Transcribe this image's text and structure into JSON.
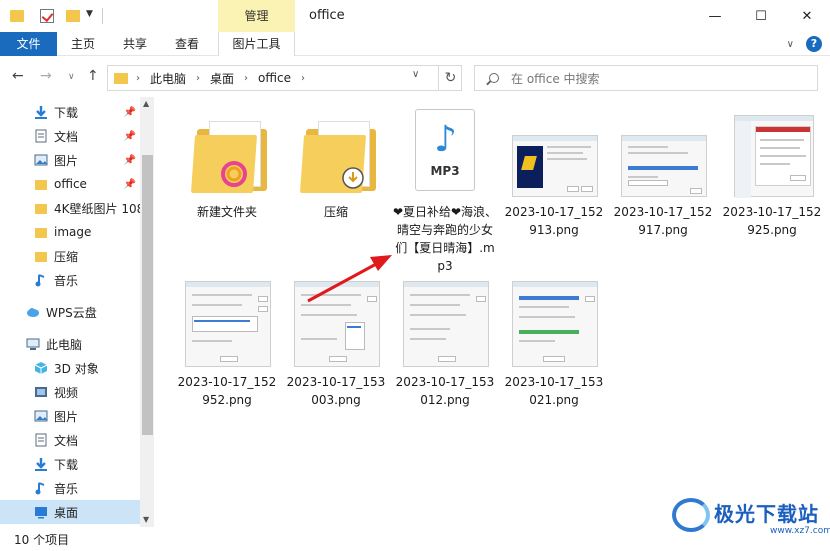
{
  "window": {
    "title": "office",
    "context_tab": "管理",
    "minimize_icon": "minimize-icon",
    "maximize_icon": "maximize-icon",
    "close_icon": "close-icon"
  },
  "ribbon": {
    "tabs": [
      "文件",
      "主页",
      "共享",
      "查看",
      "图片工具"
    ],
    "help_label": "?"
  },
  "address": {
    "segments": [
      "此电脑",
      "桌面",
      "office"
    ],
    "search_placeholder": "在 office 中搜索"
  },
  "sidebar": {
    "items": [
      {
        "label": "下载",
        "icon": "download-icon",
        "pinned": true
      },
      {
        "label": "文档",
        "icon": "document-icon",
        "pinned": true
      },
      {
        "label": "图片",
        "icon": "pictures-icon",
        "pinned": true
      },
      {
        "label": "office",
        "icon": "folder-icon",
        "pinned": true
      },
      {
        "label": "4K壁纸图片 108",
        "icon": "folder-icon",
        "pinned": false
      },
      {
        "label": "image",
        "icon": "folder-icon",
        "pinned": false
      },
      {
        "label": "压缩",
        "icon": "folder-icon",
        "pinned": false
      },
      {
        "label": "音乐",
        "icon": "music-icon",
        "pinned": false
      },
      {
        "label": "WPS云盘",
        "icon": "cloud-icon",
        "pinned": false
      },
      {
        "label": "此电脑",
        "icon": "computer-icon",
        "pinned": false
      },
      {
        "label": "3D 对象",
        "icon": "3d-objects-icon",
        "pinned": false
      },
      {
        "label": "视频",
        "icon": "video-icon",
        "pinned": false
      },
      {
        "label": "图片",
        "icon": "pictures-icon",
        "pinned": false
      },
      {
        "label": "文档",
        "icon": "document-icon",
        "pinned": false
      },
      {
        "label": "下载",
        "icon": "download-icon",
        "pinned": false
      },
      {
        "label": "音乐",
        "icon": "music-icon",
        "pinned": false
      },
      {
        "label": "桌面",
        "icon": "desktop-icon",
        "pinned": false
      }
    ]
  },
  "files": [
    {
      "name": "新建文件夹",
      "type": "folder"
    },
    {
      "name": "压缩",
      "type": "folder"
    },
    {
      "name": "❤夏日补给❤海浪、晴空与奔跑的少女们【夏日晴海】.mp3",
      "type": "mp3",
      "badge": "MP3"
    },
    {
      "name": "2023-10-17_152913.png",
      "type": "png"
    },
    {
      "name": "2023-10-17_152917.png",
      "type": "png"
    },
    {
      "name": "2023-10-17_152925.png",
      "type": "png"
    },
    {
      "name": "2023-10-17_152952.png",
      "type": "png"
    },
    {
      "name": "2023-10-17_153003.png",
      "type": "png"
    },
    {
      "name": "2023-10-17_153012.png",
      "type": "png"
    },
    {
      "name": "2023-10-17_153021.png",
      "type": "png"
    }
  ],
  "status": {
    "item_count": "10 个项目"
  },
  "watermark": {
    "brand": "极光下载站",
    "url": "www.xz7.com"
  },
  "colors": {
    "accent": "#1a6bbd",
    "selection": "#cce4f7",
    "context_tab": "#faf3b3",
    "folder": "#f3c64d",
    "arrow": "#e0191c"
  }
}
